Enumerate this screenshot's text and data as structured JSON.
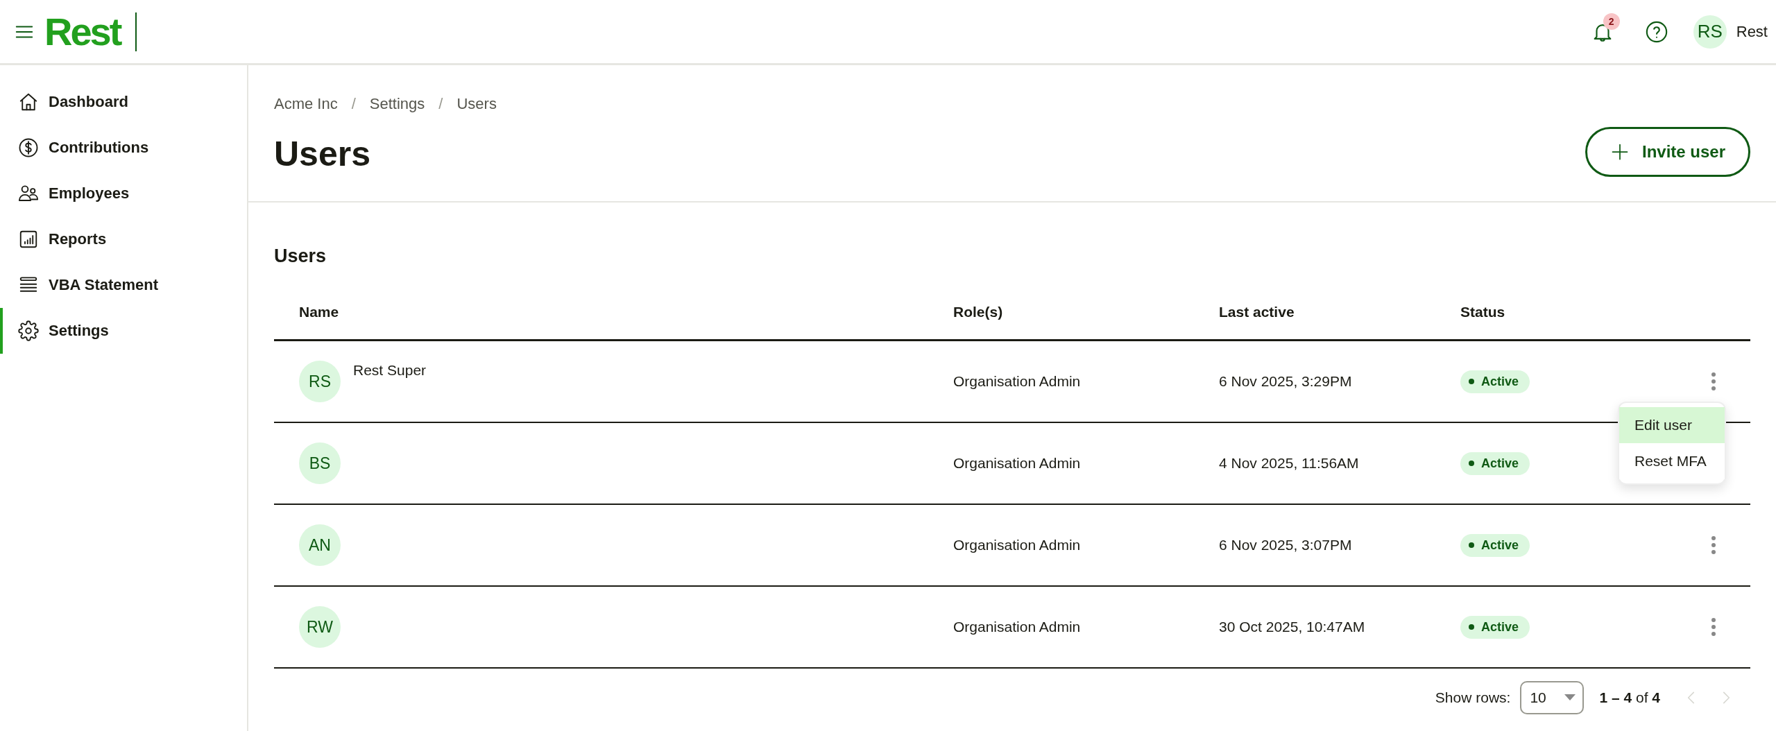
{
  "header": {
    "logo": "Rest",
    "notifications": "2",
    "avatar": "RS",
    "user": "Rest"
  },
  "sidebar": {
    "items": [
      {
        "label": "Dashboard",
        "selected": false
      },
      {
        "label": "Contributions",
        "selected": false
      },
      {
        "label": "Employees",
        "selected": false
      },
      {
        "label": "Reports",
        "selected": false
      },
      {
        "label": "VBA Statement",
        "selected": false
      },
      {
        "label": "Settings",
        "selected": true
      }
    ]
  },
  "breadcrumb": [
    {
      "text": "Acme Inc",
      "kind": "link"
    },
    {
      "text": "/",
      "kind": "separator"
    },
    {
      "text": "Settings",
      "kind": "link"
    },
    {
      "text": "/",
      "kind": "separator"
    },
    {
      "text": "Users",
      "kind": "current"
    }
  ],
  "title": "Users",
  "invite_button": "Invite user",
  "table": {
    "title": "Users",
    "columns": [
      "Name",
      "Role(s)",
      "Last active",
      "Status"
    ],
    "rows": [
      {
        "initials": "RS",
        "name": "Rest Super",
        "role": "Organisation Admin",
        "last_active": "6 Nov 2025, 3:29PM",
        "status": "Active",
        "menu_open": true
      },
      {
        "initials": "BS",
        "role": "Organisation Admin",
        "last_active": "4 Nov 2025, 11:56AM",
        "status": "Active",
        "menu_open": false
      },
      {
        "initials": "AN",
        "role": "Organisation Admin",
        "last_active": "6 Nov 2025, 3:07PM",
        "status": "Active",
        "menu_open": false
      },
      {
        "initials": "RW",
        "role": "Organisation Admin",
        "last_active": "30 Oct 2025, 10:47AM",
        "status": "Active",
        "menu_open": false
      }
    ]
  },
  "row_menu": {
    "items": [
      {
        "label": "Edit user",
        "selected": true
      },
      {
        "label": "Reset MFA",
        "selected": false
      }
    ]
  },
  "pagination": {
    "label": "Show rows:",
    "rows_per_page": "10",
    "range": "**1 – 4** of **4**",
    "prev_disabled": true,
    "next_disabled": true
  }
}
